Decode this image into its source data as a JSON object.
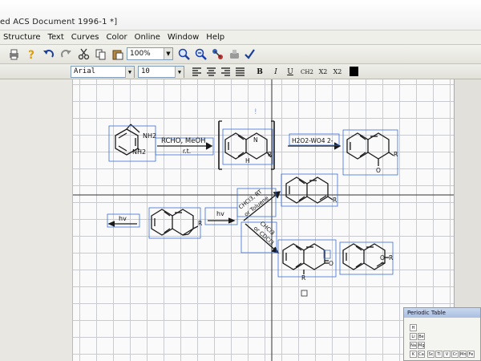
{
  "window": {
    "title": "ed ACS Document 1996-1 *]"
  },
  "menu": [
    "Structure",
    "Text",
    "Curves",
    "Color",
    "Online",
    "Window",
    "Help"
  ],
  "toolbar": {
    "zoom": "100%"
  },
  "format": {
    "font": "Arial",
    "size": "10",
    "bold": "B",
    "italic": "I",
    "underline": "U",
    "ch2": "CH2",
    "subscript": "X2",
    "superscript": "X2"
  },
  "reaction": {
    "nh2_top": "NH2",
    "nh2_bottom": "NH2",
    "reagent1": "RCHO, MeOH",
    "cond1": "r.t.",
    "h1": "H",
    "n1": "N",
    "r1": "R",
    "reagent2": "H2O2-WO4 2-",
    "r2": "R",
    "o_minus": "O",
    "hv_left": "hv",
    "hv_mid": "hv",
    "r3": "R",
    "diag_up1": "CHCl3, RT",
    "diag_up2": "or Toluene",
    "diag_down1": "CHCl3",
    "diag_down2": "or CDCl3",
    "r4": "R",
    "o_ketone": "O",
    "r5": "R",
    "o_ether": "O",
    "r6": "R"
  },
  "periodic_table": {
    "title": "Periodic Table",
    "elements": [
      "H",
      "Li",
      "Be",
      "Na",
      "Mg",
      "K",
      "Ca",
      "Sc",
      "Ti",
      "V",
      "Cr",
      "Mn",
      "Fe"
    ]
  }
}
